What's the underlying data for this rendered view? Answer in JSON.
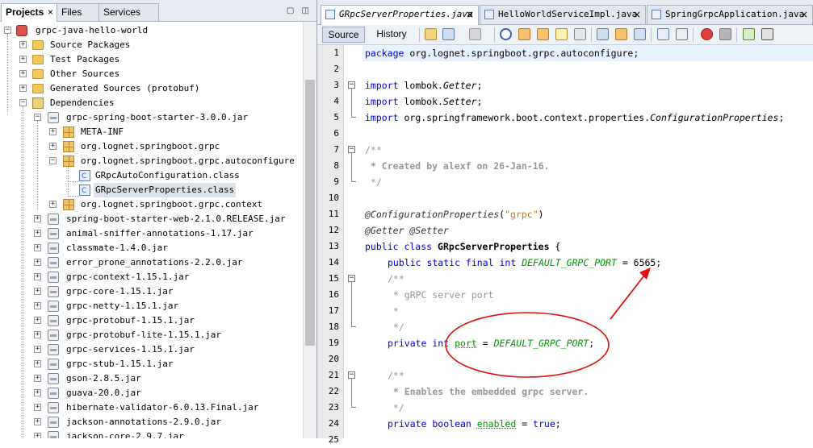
{
  "left_tabs": [
    {
      "label": "Projects",
      "close": "×"
    },
    {
      "label": "Files"
    },
    {
      "label": "Services"
    }
  ],
  "window_controls": "▢ ◫",
  "tree": [
    {
      "label": "grpc-java-hello-world",
      "toggle": "−",
      "icon": "project"
    },
    {
      "label": "Source Packages",
      "toggle": "+",
      "icon": "folder"
    },
    {
      "label": "Test Packages",
      "toggle": "+",
      "icon": "folder"
    },
    {
      "label": "Other Sources",
      "toggle": "+",
      "icon": "folder"
    },
    {
      "label": "Generated Sources (protobuf)",
      "toggle": "+",
      "icon": "folder"
    },
    {
      "label": "Dependencies",
      "toggle": "−",
      "icon": "dependencies"
    },
    {
      "label": "grpc-spring-boot-starter-3.0.0.jar",
      "toggle": "−",
      "icon": "jar"
    },
    {
      "label": "META-INF",
      "toggle": "+",
      "icon": "package"
    },
    {
      "label": "org.lognet.springboot.grpc",
      "toggle": "+",
      "icon": "package"
    },
    {
      "label": "org.lognet.springboot.grpc.autoconfigure",
      "toggle": "−",
      "icon": "package"
    },
    {
      "label": "GRpcAutoConfiguration.class",
      "icon": "class"
    },
    {
      "label": "GRpcServerProperties.class",
      "icon": "class",
      "selected": true
    },
    {
      "label": "org.lognet.springboot.grpc.context",
      "toggle": "+",
      "icon": "package"
    },
    {
      "label": "spring-boot-starter-web-2.1.0.RELEASE.jar",
      "toggle": "+",
      "icon": "jar"
    },
    {
      "label": "animal-sniffer-annotations-1.17.jar",
      "toggle": "+",
      "icon": "jar"
    },
    {
      "label": "classmate-1.4.0.jar",
      "toggle": "+",
      "icon": "jar"
    },
    {
      "label": "error_prone_annotations-2.2.0.jar",
      "toggle": "+",
      "icon": "jar"
    },
    {
      "label": "grpc-context-1.15.1.jar",
      "toggle": "+",
      "icon": "jar"
    },
    {
      "label": "grpc-core-1.15.1.jar",
      "toggle": "+",
      "icon": "jar"
    },
    {
      "label": "grpc-netty-1.15.1.jar",
      "toggle": "+",
      "icon": "jar"
    },
    {
      "label": "grpc-protobuf-1.15.1.jar",
      "toggle": "+",
      "icon": "jar"
    },
    {
      "label": "grpc-protobuf-lite-1.15.1.jar",
      "toggle": "+",
      "icon": "jar"
    },
    {
      "label": "grpc-services-1.15.1.jar",
      "toggle": "+",
      "icon": "jar"
    },
    {
      "label": "grpc-stub-1.15.1.jar",
      "toggle": "+",
      "icon": "jar"
    },
    {
      "label": "gson-2.8.5.jar",
      "toggle": "+",
      "icon": "jar"
    },
    {
      "label": "guava-20.0.jar",
      "toggle": "+",
      "icon": "jar"
    },
    {
      "label": "hibernate-validator-6.0.13.Final.jar",
      "toggle": "+",
      "icon": "jar"
    },
    {
      "label": "jackson-annotations-2.9.0.jar",
      "toggle": "+",
      "icon": "jar"
    },
    {
      "label": "jackson-core-2.9.7.jar",
      "toggle": "+",
      "icon": "jar"
    }
  ],
  "editor_tabs": [
    {
      "label": "GRpcServerProperties.java",
      "close": "×",
      "active": true
    },
    {
      "label": "HelloWorldServiceImpl.java",
      "close": "×"
    },
    {
      "label": "SpringGrpcApplication.java",
      "close": "×"
    }
  ],
  "toolbar": {
    "source": "Source",
    "history": "History"
  },
  "line_numbers": [
    "1",
    "2",
    "3",
    "4",
    "5",
    "6",
    "7",
    "8",
    "9",
    "10",
    "11",
    "12",
    "13",
    "14",
    "15",
    "16",
    "17",
    "18",
    "19",
    "20",
    "21",
    "22",
    "23",
    "24",
    "25"
  ],
  "code": {
    "l1": [
      "package",
      " org.lognet.springboot.grpc.autoconfigure;"
    ],
    "l3": [
      "import",
      " lombok.",
      "Getter",
      ";"
    ],
    "l4": [
      "import",
      " lombok.",
      "Setter",
      ";"
    ],
    "l5": [
      "import",
      " org.springframework.boot.context.properties.",
      "ConfigurationProperties",
      ";"
    ],
    "l7": "/**",
    "l8": " * Created by alexf on 26-Jan-16.",
    "l9": " */",
    "l11": [
      "@ConfigurationProperties",
      "(",
      "\"grpc\"",
      ")"
    ],
    "l12": "@Getter @Setter",
    "l13": [
      "public class",
      " GRpcServerProperties",
      " {"
    ],
    "l14": [
      "public static final int",
      " ",
      "DEFAULT_GRPC_PORT",
      " = 6565;"
    ],
    "l15": "/**",
    "l16": " * gRPC server port",
    "l17": " *",
    "l18": " */",
    "l19": [
      "private int",
      " ",
      "port",
      " = ",
      "DEFAULT_GRPC_PORT",
      ";"
    ],
    "l21": "/**",
    "l22": " * Enables the embedded grpc server.",
    "l23": " */",
    "l24": [
      "private boolean",
      " ",
      "enabled",
      " = ",
      "true",
      ";"
    ]
  },
  "colors": {
    "keyword": "#0000e6",
    "constant": "#009900",
    "comment": "#969696",
    "string": "#ce7b00",
    "annotation_mark": "#e01010",
    "current_line": "#e8f2fe"
  }
}
